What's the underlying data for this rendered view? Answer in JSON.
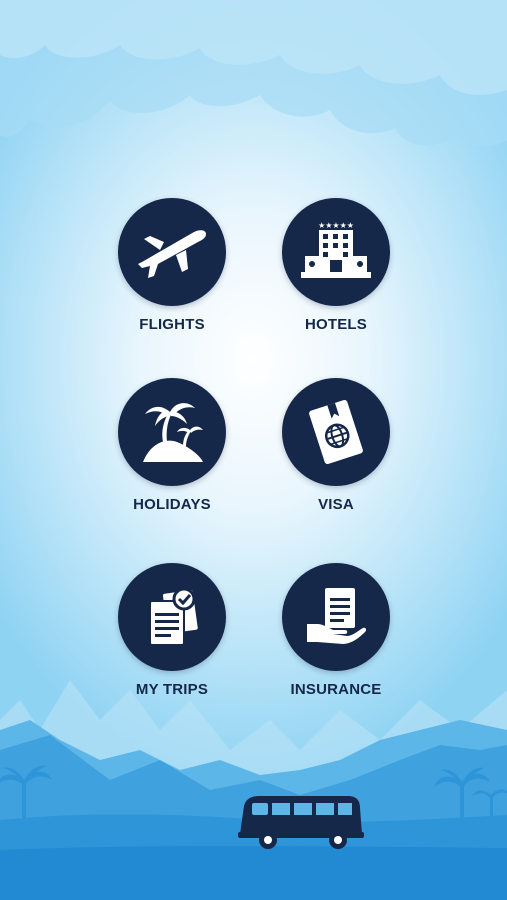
{
  "menu": {
    "items": [
      {
        "id": "flights",
        "label": "FLIGHTS",
        "icon": "airplane-icon"
      },
      {
        "id": "hotels",
        "label": "HOTELS",
        "icon": "hotel-building-icon"
      },
      {
        "id": "holidays",
        "label": "HOLIDAYS",
        "icon": "palm-island-icon"
      },
      {
        "id": "visa",
        "label": "VISA",
        "icon": "passport-icon"
      },
      {
        "id": "mytrips",
        "label": "MY TRIPS",
        "icon": "documents-check-icon"
      },
      {
        "id": "insurance",
        "label": "INSURANCE",
        "icon": "hand-document-icon"
      }
    ]
  },
  "colors": {
    "icon_bg": "#16284a",
    "label": "#16284a",
    "sky": "#8fd3f3",
    "mountain": "#3fa6e0",
    "vehicle": "#16284a"
  },
  "scene": {
    "vehicle_icon": "bus-icon",
    "tree_icon": "palm-tree-icon"
  }
}
